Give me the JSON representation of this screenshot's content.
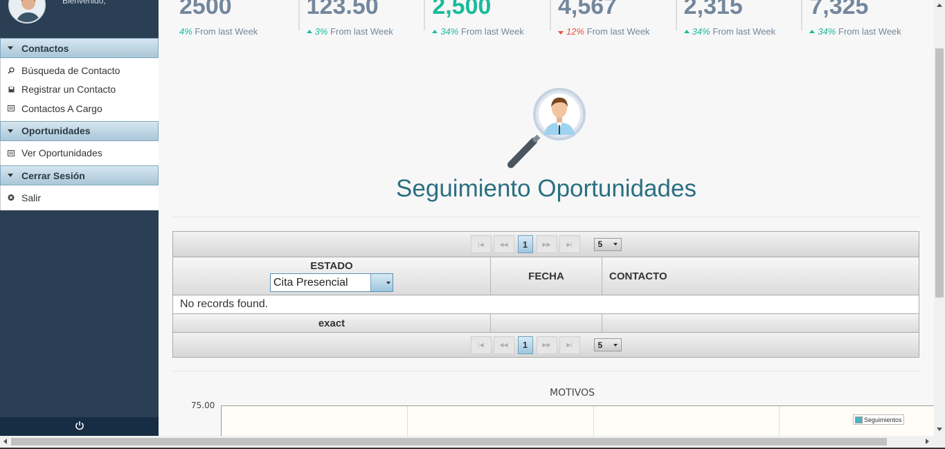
{
  "sidebar": {
    "welcome": "Bienvenido,",
    "sections": [
      {
        "title": "Contactos",
        "items": [
          {
            "label": "Búsqueda de Contacto",
            "icon": "search-icon"
          },
          {
            "label": "Registrar un Contacto",
            "icon": "save-icon"
          },
          {
            "label": "Contactos A Cargo",
            "icon": "list-icon"
          }
        ]
      },
      {
        "title": "Oportunidades",
        "items": [
          {
            "label": "Ver Oportunidades",
            "icon": "list-icon"
          }
        ]
      },
      {
        "title": "Cerrar Sesión",
        "items": [
          {
            "label": "Salir",
            "icon": "close-circle-icon"
          }
        ]
      }
    ],
    "footer_icon": "power-icon"
  },
  "tiles": [
    {
      "value": "2500",
      "pct": "4%",
      "text": "From last Week",
      "trend": "none",
      "color": "#73879c"
    },
    {
      "value": "123.50",
      "pct": "3%",
      "text": "From last Week",
      "trend": "up",
      "color": "#73879c"
    },
    {
      "value": "2,500",
      "pct": "34%",
      "text": "From last Week",
      "trend": "up",
      "color": "#1abb9c"
    },
    {
      "value": "4,567",
      "pct": "12%",
      "text": "From last Week",
      "trend": "down",
      "color": "#73879c"
    },
    {
      "value": "2,315",
      "pct": "34%",
      "text": "From last Week",
      "trend": "up",
      "color": "#73879c"
    },
    {
      "value": "7,325",
      "pct": "34%",
      "text": "From last Week",
      "trend": "up",
      "color": "#73879c"
    }
  ],
  "page_title": "Seguimiento Oportunidades",
  "table": {
    "current_page": "1",
    "rows_per_page": "5",
    "columns": {
      "estado": "ESTADO",
      "fecha": "FECHA",
      "contacto": "CONTACTO"
    },
    "estado_filter_value": "Cita Presencial",
    "empty_message": "No records found.",
    "footer": {
      "estado": "exact",
      "fecha": "",
      "contacto": ""
    }
  },
  "chart_data": {
    "type": "bar",
    "title": "MOTIVOS",
    "yticks": [
      "75.00"
    ],
    "series": [
      {
        "name": "Seguimientos",
        "values": []
      }
    ],
    "legend_position": "right",
    "colors": {
      "Seguimientos": "#4bb2c5"
    }
  }
}
